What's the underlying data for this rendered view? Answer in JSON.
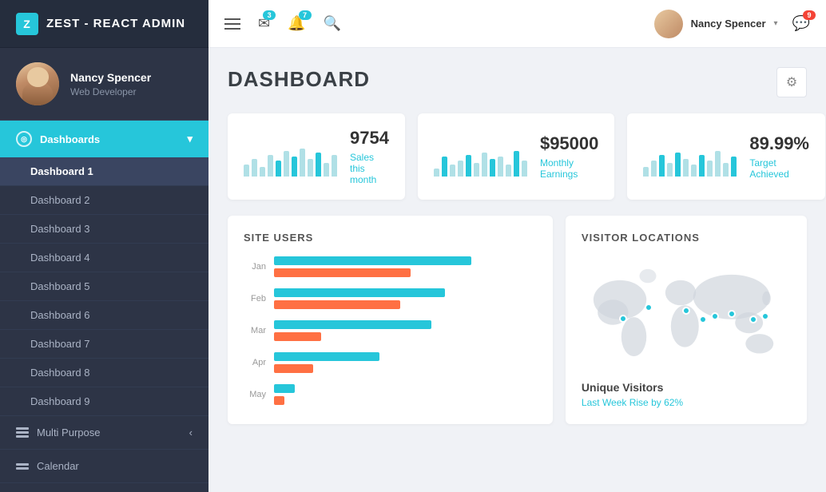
{
  "sidebar": {
    "logo_text": "ZEST - REACT ADMIN",
    "logo_symbol": "Z",
    "user": {
      "name": "Nancy Spencer",
      "role": "Web Developer"
    },
    "nav_groups": [
      {
        "label": "Dashboards",
        "icon": "circle",
        "expanded": true,
        "items": [
          {
            "label": "Dashboard 1",
            "active": true
          },
          {
            "label": "Dashboard 2",
            "active": false
          },
          {
            "label": "Dashboard 3",
            "active": false
          },
          {
            "label": "Dashboard 4",
            "active": false
          },
          {
            "label": "Dashboard 5",
            "active": false
          },
          {
            "label": "Dashboard 6",
            "active": false
          },
          {
            "label": "Dashboard 7",
            "active": false
          },
          {
            "label": "Dashboard 8",
            "active": false
          },
          {
            "label": "Dashboard 9",
            "active": false
          }
        ]
      },
      {
        "label": "Multi Purpose",
        "icon": "stack",
        "expanded": false,
        "items": []
      },
      {
        "label": "Calendar",
        "icon": "calendar",
        "expanded": false,
        "items": []
      }
    ]
  },
  "topbar": {
    "menu_icon": "☰",
    "email_badge": "3",
    "bell_badge": "7",
    "chat_badge": "9",
    "user_name": "Nancy Spencer",
    "chevron": "▾"
  },
  "page": {
    "title": "DASHBOARD",
    "settings_icon": "⚙"
  },
  "stat_cards": [
    {
      "value": "9754",
      "label": "Sales this month",
      "bars": [
        30,
        45,
        25,
        55,
        40,
        65,
        50,
        70,
        45,
        60,
        35,
        55
      ]
    },
    {
      "value": "$95000",
      "label": "Monthly Earnings",
      "bars": [
        20,
        50,
        30,
        40,
        55,
        35,
        60,
        45,
        50,
        30,
        65,
        40
      ]
    },
    {
      "value": "89.99%",
      "label": "Target Achieved",
      "bars": [
        25,
        40,
        55,
        35,
        60,
        45,
        30,
        55,
        40,
        65,
        35,
        50
      ]
    }
  ],
  "site_users": {
    "title": "SITE USERS",
    "bars": [
      {
        "label": "Jan",
        "teal": 75,
        "orange": 52
      },
      {
        "label": "Feb",
        "teal": 65,
        "orange": 48
      },
      {
        "label": "Mar",
        "teal": 60,
        "orange": 20
      },
      {
        "label": "Apr",
        "teal": 42,
        "orange": 18
      },
      {
        "label": "May",
        "teal": 10,
        "orange": 5
      }
    ]
  },
  "visitor_locations": {
    "title": "VISITOR LOCATIONS",
    "unique_visitors_title": "Unique Visitors",
    "unique_visitors_sub": "Last Week Rise by 62%",
    "dots": [
      {
        "left": "18%",
        "top": "52%"
      },
      {
        "left": "30%",
        "top": "42%"
      },
      {
        "left": "48%",
        "top": "48%"
      },
      {
        "left": "56%",
        "top": "55%"
      },
      {
        "left": "62%",
        "top": "52%"
      },
      {
        "left": "70%",
        "top": "50%"
      },
      {
        "left": "80%",
        "top": "55%"
      },
      {
        "left": "85%",
        "top": "52%"
      }
    ]
  }
}
